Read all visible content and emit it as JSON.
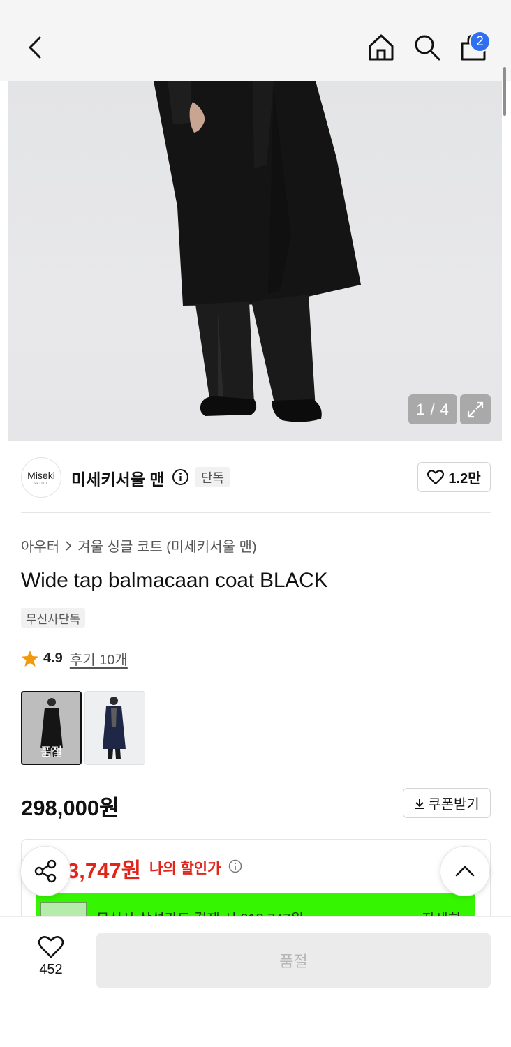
{
  "header": {
    "cart_count": "2",
    "icons": [
      "chevron-left-icon",
      "home-icon",
      "search-icon",
      "shopping-bag-icon"
    ]
  },
  "gallery": {
    "counter": "1 / 4"
  },
  "brand": {
    "logo_text": "Miseki",
    "logo_subtext": "SEOUL",
    "name": "미세키서울 맨",
    "tag": "단독",
    "likes": "1.2만"
  },
  "product": {
    "breadcrumb": [
      "아우터",
      "겨울 싱글 코트 (미세키서울 맨)"
    ],
    "title": "Wide tap balmacaan coat BLACK",
    "exclusive_badge": "무신사단독",
    "rating": "4.9",
    "reviews": "후기 10개",
    "thumbnails": [
      {
        "label": "품절",
        "selected": true
      },
      {
        "label": "",
        "selected": false
      }
    ],
    "price": "298,000원",
    "coupon_label": "쿠폰받기"
  },
  "discount": {
    "my_price": "3,747원",
    "my_price_label": "나의 할인가",
    "card_text": "무신사 삼성카드 결제 시 218,747원",
    "card_more": "자세히",
    "colors": {
      "price_red": "#e1251b",
      "banner_green": "#35f500"
    }
  },
  "bottom": {
    "wish_count": "452",
    "buy_label": "품절"
  }
}
